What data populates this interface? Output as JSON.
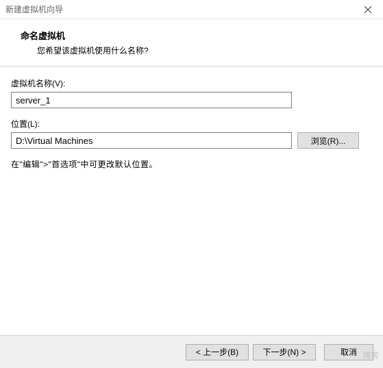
{
  "window": {
    "title": "新建虚拟机向导"
  },
  "header": {
    "heading": "命名虚拟机",
    "subtext": "您希望该虚拟机使用什么名称?"
  },
  "form": {
    "name_label": "虚拟机名称(V):",
    "name_value": "server_1",
    "location_label": "位置(L):",
    "location_value": "D:\\Virtual Machines",
    "browse_label": "浏览(R)...",
    "hint": "在\"编辑\">\"首选项\"中可更改默认位置。"
  },
  "footer": {
    "back_label": "< 上一步(B)",
    "next_label": "下一步(N) >",
    "cancel_label": "取消"
  },
  "watermark": "博客"
}
